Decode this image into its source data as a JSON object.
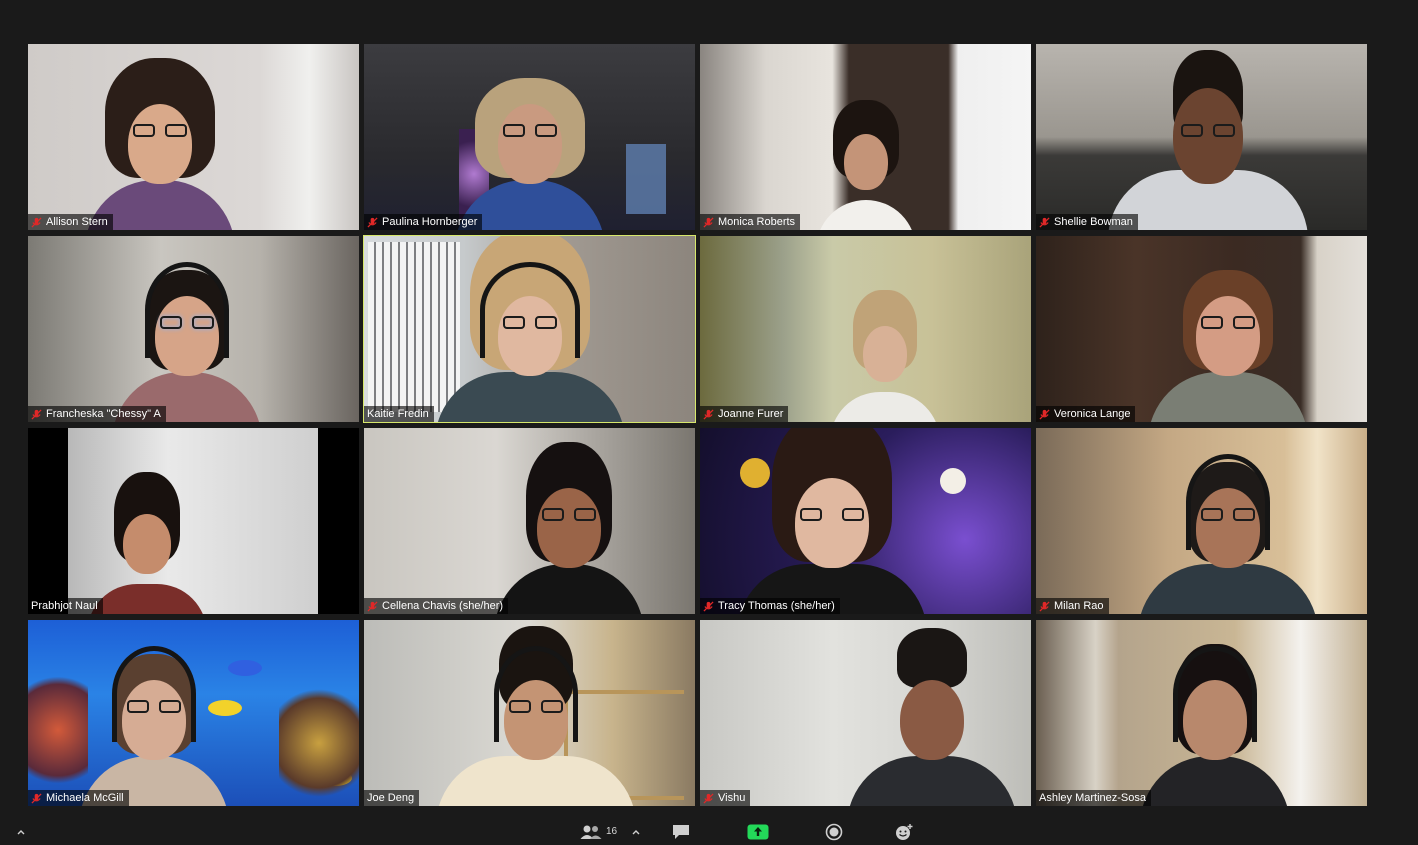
{
  "meeting": {
    "participants": [
      {
        "name": "Allison Stern",
        "muted": true
      },
      {
        "name": "Paulina Hornberger",
        "muted": true
      },
      {
        "name": "Monica Roberts",
        "muted": true
      },
      {
        "name": "Shellie Bowman",
        "muted": true
      },
      {
        "name": "Francheska \"Chessy\" A",
        "muted": true
      },
      {
        "name": "Kaitie Fredin",
        "muted": false,
        "active_speaker": true
      },
      {
        "name": "Joanne Furer",
        "muted": true
      },
      {
        "name": "Veronica Lange",
        "muted": true
      },
      {
        "name": "Prabhjot Naul",
        "muted": false
      },
      {
        "name": "Cellena Chavis (she/her)",
        "muted": true
      },
      {
        "name": "Tracy Thomas (she/her)",
        "muted": true
      },
      {
        "name": "Milan Rao",
        "muted": true
      },
      {
        "name": "Michaela McGill",
        "muted": true
      },
      {
        "name": "Joe Deng",
        "muted": false
      },
      {
        "name": "Vishu",
        "muted": true
      },
      {
        "name": "Ashley Martinez-Sosa",
        "muted": false
      }
    ]
  },
  "toolbar": {
    "participants_count": "16",
    "icons": [
      "chevron-up-icon",
      "participants-icon",
      "chevron-up-icon",
      "chat-icon",
      "share-screen-icon",
      "record-icon",
      "reactions-icon"
    ]
  },
  "colors": {
    "background": "#1a1a1a",
    "active_speaker_border": "#d7e86b",
    "mute_red": "#e02828",
    "share_green": "#23d959"
  }
}
